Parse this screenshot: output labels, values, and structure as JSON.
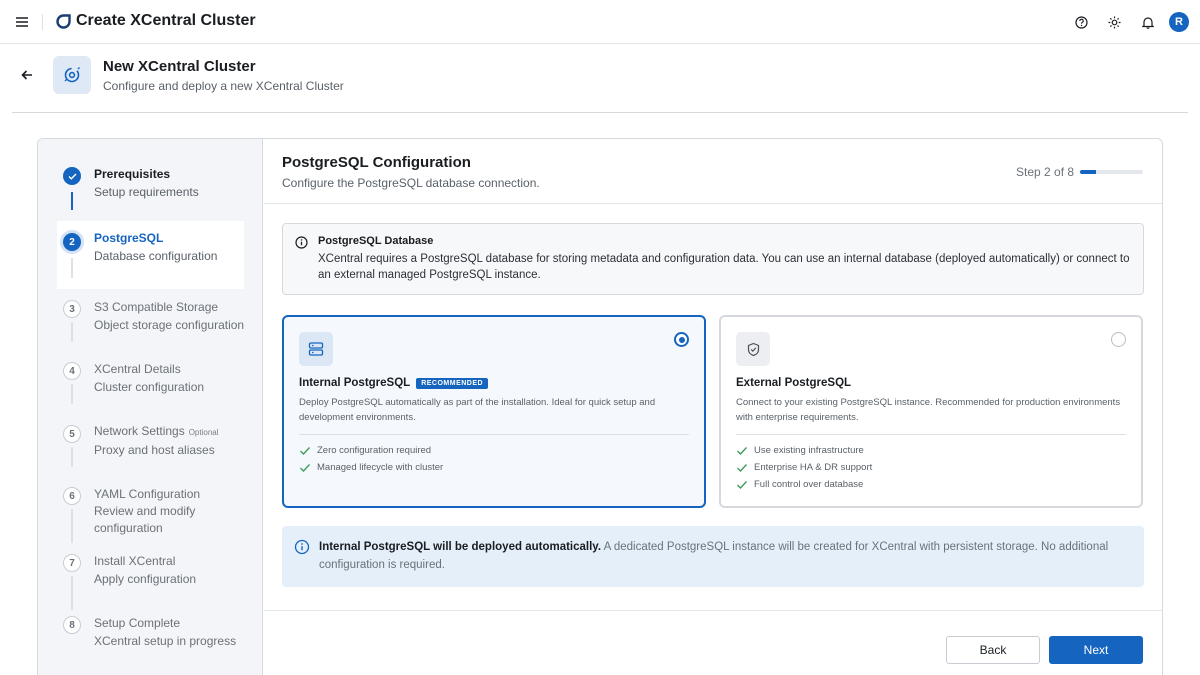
{
  "topbar": {
    "app_title": "Create XCentral Cluster",
    "avatar_initial": "R",
    "icons": [
      "menu-icon",
      "app-logo-icon",
      "help-icon",
      "theme-sun-icon",
      "notifications-bell-icon"
    ]
  },
  "header": {
    "title": "New XCentral Cluster",
    "subtitle": "Configure and deploy a new XCentral Cluster"
  },
  "steps": [
    {
      "number": "1",
      "title": "Prerequisites",
      "subtitle": "Setup requirements",
      "state": "done"
    },
    {
      "number": "2",
      "title": "PostgreSQL",
      "subtitle": "Database configuration",
      "state": "current"
    },
    {
      "number": "3",
      "title": "S3 Compatible Storage",
      "subtitle": "Object storage configuration",
      "state": "todo"
    },
    {
      "number": "4",
      "title": "XCentral Details",
      "subtitle": "Cluster configuration",
      "state": "todo"
    },
    {
      "number": "5",
      "title": "Network Settings",
      "optional": "Optional",
      "subtitle": "Proxy and host aliases",
      "state": "todo"
    },
    {
      "number": "6",
      "title": "YAML Configuration",
      "subtitle": "Review and modify configuration",
      "state": "todo"
    },
    {
      "number": "7",
      "title": "Install XCentral",
      "subtitle": "Apply configuration",
      "state": "todo"
    },
    {
      "number": "8",
      "title": "Setup Complete",
      "subtitle": "XCentral setup in progress",
      "state": "todo"
    }
  ],
  "section": {
    "title": "PostgreSQL Configuration",
    "subtitle": "Configure the PostgreSQL database connection.",
    "step_indicator": "Step 2 of 8",
    "progress_fraction": 0.25
  },
  "info": {
    "title": "PostgreSQL Database",
    "body": "XCentral requires a PostgreSQL database for storing metadata and configuration data. You can use an internal database (deployed automatically) or connect to an external managed PostgreSQL instance."
  },
  "options": {
    "internal": {
      "title": "Internal PostgreSQL",
      "badge": "RECOMMENDED",
      "description": "Deploy PostgreSQL automatically as part of the installation. Ideal for quick setup and development environments.",
      "features": [
        "Zero configuration required",
        "Managed lifecycle with cluster"
      ],
      "selected": true
    },
    "external": {
      "title": "External PostgreSQL",
      "description": "Connect to your existing PostgreSQL instance. Recommended for production environments with enterprise requirements.",
      "features": [
        "Use existing infrastructure",
        "Enterprise HA & DR support",
        "Full control over database"
      ],
      "selected": false
    }
  },
  "notice": {
    "strong": "Internal PostgreSQL will be deployed automatically.",
    "text": " A dedicated PostgreSQL instance will be created for XCentral with persistent storage. No additional configuration is required."
  },
  "buttons": {
    "back": "Back",
    "next": "Next"
  },
  "colors": {
    "accent": "#1565c0",
    "sidebar_bg": "#f3f5f8",
    "notice_bg": "#e5eff9",
    "check_green": "#3a9a5b"
  }
}
